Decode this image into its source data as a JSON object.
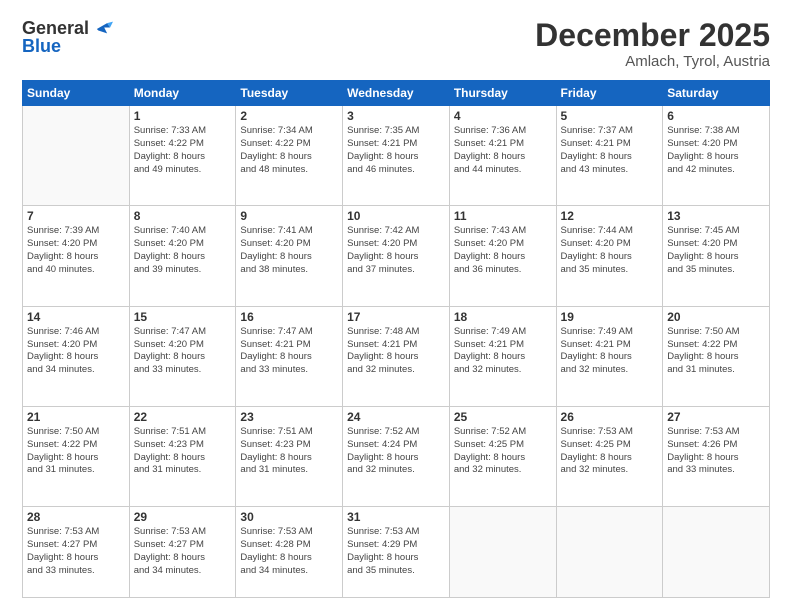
{
  "header": {
    "logo_general": "General",
    "logo_blue": "Blue",
    "month": "December 2025",
    "location": "Amlach, Tyrol, Austria"
  },
  "weekdays": [
    "Sunday",
    "Monday",
    "Tuesday",
    "Wednesday",
    "Thursday",
    "Friday",
    "Saturday"
  ],
  "weeks": [
    [
      {
        "day": "",
        "info": ""
      },
      {
        "day": "1",
        "info": "Sunrise: 7:33 AM\nSunset: 4:22 PM\nDaylight: 8 hours\nand 49 minutes."
      },
      {
        "day": "2",
        "info": "Sunrise: 7:34 AM\nSunset: 4:22 PM\nDaylight: 8 hours\nand 48 minutes."
      },
      {
        "day": "3",
        "info": "Sunrise: 7:35 AM\nSunset: 4:21 PM\nDaylight: 8 hours\nand 46 minutes."
      },
      {
        "day": "4",
        "info": "Sunrise: 7:36 AM\nSunset: 4:21 PM\nDaylight: 8 hours\nand 44 minutes."
      },
      {
        "day": "5",
        "info": "Sunrise: 7:37 AM\nSunset: 4:21 PM\nDaylight: 8 hours\nand 43 minutes."
      },
      {
        "day": "6",
        "info": "Sunrise: 7:38 AM\nSunset: 4:20 PM\nDaylight: 8 hours\nand 42 minutes."
      }
    ],
    [
      {
        "day": "7",
        "info": "Sunrise: 7:39 AM\nSunset: 4:20 PM\nDaylight: 8 hours\nand 40 minutes."
      },
      {
        "day": "8",
        "info": "Sunrise: 7:40 AM\nSunset: 4:20 PM\nDaylight: 8 hours\nand 39 minutes."
      },
      {
        "day": "9",
        "info": "Sunrise: 7:41 AM\nSunset: 4:20 PM\nDaylight: 8 hours\nand 38 minutes."
      },
      {
        "day": "10",
        "info": "Sunrise: 7:42 AM\nSunset: 4:20 PM\nDaylight: 8 hours\nand 37 minutes."
      },
      {
        "day": "11",
        "info": "Sunrise: 7:43 AM\nSunset: 4:20 PM\nDaylight: 8 hours\nand 36 minutes."
      },
      {
        "day": "12",
        "info": "Sunrise: 7:44 AM\nSunset: 4:20 PM\nDaylight: 8 hours\nand 35 minutes."
      },
      {
        "day": "13",
        "info": "Sunrise: 7:45 AM\nSunset: 4:20 PM\nDaylight: 8 hours\nand 35 minutes."
      }
    ],
    [
      {
        "day": "14",
        "info": "Sunrise: 7:46 AM\nSunset: 4:20 PM\nDaylight: 8 hours\nand 34 minutes."
      },
      {
        "day": "15",
        "info": "Sunrise: 7:47 AM\nSunset: 4:20 PM\nDaylight: 8 hours\nand 33 minutes."
      },
      {
        "day": "16",
        "info": "Sunrise: 7:47 AM\nSunset: 4:21 PM\nDaylight: 8 hours\nand 33 minutes."
      },
      {
        "day": "17",
        "info": "Sunrise: 7:48 AM\nSunset: 4:21 PM\nDaylight: 8 hours\nand 32 minutes."
      },
      {
        "day": "18",
        "info": "Sunrise: 7:49 AM\nSunset: 4:21 PM\nDaylight: 8 hours\nand 32 minutes."
      },
      {
        "day": "19",
        "info": "Sunrise: 7:49 AM\nSunset: 4:21 PM\nDaylight: 8 hours\nand 32 minutes."
      },
      {
        "day": "20",
        "info": "Sunrise: 7:50 AM\nSunset: 4:22 PM\nDaylight: 8 hours\nand 31 minutes."
      }
    ],
    [
      {
        "day": "21",
        "info": "Sunrise: 7:50 AM\nSunset: 4:22 PM\nDaylight: 8 hours\nand 31 minutes."
      },
      {
        "day": "22",
        "info": "Sunrise: 7:51 AM\nSunset: 4:23 PM\nDaylight: 8 hours\nand 31 minutes."
      },
      {
        "day": "23",
        "info": "Sunrise: 7:51 AM\nSunset: 4:23 PM\nDaylight: 8 hours\nand 31 minutes."
      },
      {
        "day": "24",
        "info": "Sunrise: 7:52 AM\nSunset: 4:24 PM\nDaylight: 8 hours\nand 32 minutes."
      },
      {
        "day": "25",
        "info": "Sunrise: 7:52 AM\nSunset: 4:25 PM\nDaylight: 8 hours\nand 32 minutes."
      },
      {
        "day": "26",
        "info": "Sunrise: 7:53 AM\nSunset: 4:25 PM\nDaylight: 8 hours\nand 32 minutes."
      },
      {
        "day": "27",
        "info": "Sunrise: 7:53 AM\nSunset: 4:26 PM\nDaylight: 8 hours\nand 33 minutes."
      }
    ],
    [
      {
        "day": "28",
        "info": "Sunrise: 7:53 AM\nSunset: 4:27 PM\nDaylight: 8 hours\nand 33 minutes."
      },
      {
        "day": "29",
        "info": "Sunrise: 7:53 AM\nSunset: 4:27 PM\nDaylight: 8 hours\nand 34 minutes."
      },
      {
        "day": "30",
        "info": "Sunrise: 7:53 AM\nSunset: 4:28 PM\nDaylight: 8 hours\nand 34 minutes."
      },
      {
        "day": "31",
        "info": "Sunrise: 7:53 AM\nSunset: 4:29 PM\nDaylight: 8 hours\nand 35 minutes."
      },
      {
        "day": "",
        "info": ""
      },
      {
        "day": "",
        "info": ""
      },
      {
        "day": "",
        "info": ""
      }
    ]
  ]
}
